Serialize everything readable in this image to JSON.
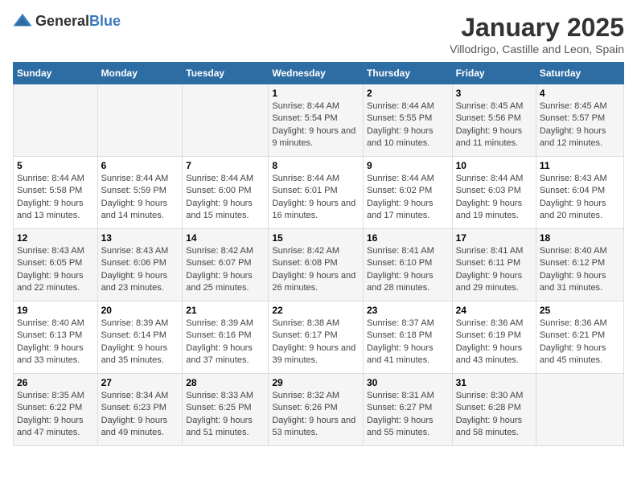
{
  "header": {
    "logo_general": "General",
    "logo_blue": "Blue",
    "title": "January 2025",
    "subtitle": "Villodrigo, Castille and Leon, Spain"
  },
  "days_of_week": [
    "Sunday",
    "Monday",
    "Tuesday",
    "Wednesday",
    "Thursday",
    "Friday",
    "Saturday"
  ],
  "weeks": [
    [
      {
        "day": "",
        "info": ""
      },
      {
        "day": "",
        "info": ""
      },
      {
        "day": "",
        "info": ""
      },
      {
        "day": "1",
        "info": "Sunrise: 8:44 AM\nSunset: 5:54 PM\nDaylight: 9 hours and 9 minutes."
      },
      {
        "day": "2",
        "info": "Sunrise: 8:44 AM\nSunset: 5:55 PM\nDaylight: 9 hours and 10 minutes."
      },
      {
        "day": "3",
        "info": "Sunrise: 8:45 AM\nSunset: 5:56 PM\nDaylight: 9 hours and 11 minutes."
      },
      {
        "day": "4",
        "info": "Sunrise: 8:45 AM\nSunset: 5:57 PM\nDaylight: 9 hours and 12 minutes."
      }
    ],
    [
      {
        "day": "5",
        "info": "Sunrise: 8:44 AM\nSunset: 5:58 PM\nDaylight: 9 hours and 13 minutes."
      },
      {
        "day": "6",
        "info": "Sunrise: 8:44 AM\nSunset: 5:59 PM\nDaylight: 9 hours and 14 minutes."
      },
      {
        "day": "7",
        "info": "Sunrise: 8:44 AM\nSunset: 6:00 PM\nDaylight: 9 hours and 15 minutes."
      },
      {
        "day": "8",
        "info": "Sunrise: 8:44 AM\nSunset: 6:01 PM\nDaylight: 9 hours and 16 minutes."
      },
      {
        "day": "9",
        "info": "Sunrise: 8:44 AM\nSunset: 6:02 PM\nDaylight: 9 hours and 17 minutes."
      },
      {
        "day": "10",
        "info": "Sunrise: 8:44 AM\nSunset: 6:03 PM\nDaylight: 9 hours and 19 minutes."
      },
      {
        "day": "11",
        "info": "Sunrise: 8:43 AM\nSunset: 6:04 PM\nDaylight: 9 hours and 20 minutes."
      }
    ],
    [
      {
        "day": "12",
        "info": "Sunrise: 8:43 AM\nSunset: 6:05 PM\nDaylight: 9 hours and 22 minutes."
      },
      {
        "day": "13",
        "info": "Sunrise: 8:43 AM\nSunset: 6:06 PM\nDaylight: 9 hours and 23 minutes."
      },
      {
        "day": "14",
        "info": "Sunrise: 8:42 AM\nSunset: 6:07 PM\nDaylight: 9 hours and 25 minutes."
      },
      {
        "day": "15",
        "info": "Sunrise: 8:42 AM\nSunset: 6:08 PM\nDaylight: 9 hours and 26 minutes."
      },
      {
        "day": "16",
        "info": "Sunrise: 8:41 AM\nSunset: 6:10 PM\nDaylight: 9 hours and 28 minutes."
      },
      {
        "day": "17",
        "info": "Sunrise: 8:41 AM\nSunset: 6:11 PM\nDaylight: 9 hours and 29 minutes."
      },
      {
        "day": "18",
        "info": "Sunrise: 8:40 AM\nSunset: 6:12 PM\nDaylight: 9 hours and 31 minutes."
      }
    ],
    [
      {
        "day": "19",
        "info": "Sunrise: 8:40 AM\nSunset: 6:13 PM\nDaylight: 9 hours and 33 minutes."
      },
      {
        "day": "20",
        "info": "Sunrise: 8:39 AM\nSunset: 6:14 PM\nDaylight: 9 hours and 35 minutes."
      },
      {
        "day": "21",
        "info": "Sunrise: 8:39 AM\nSunset: 6:16 PM\nDaylight: 9 hours and 37 minutes."
      },
      {
        "day": "22",
        "info": "Sunrise: 8:38 AM\nSunset: 6:17 PM\nDaylight: 9 hours and 39 minutes."
      },
      {
        "day": "23",
        "info": "Sunrise: 8:37 AM\nSunset: 6:18 PM\nDaylight: 9 hours and 41 minutes."
      },
      {
        "day": "24",
        "info": "Sunrise: 8:36 AM\nSunset: 6:19 PM\nDaylight: 9 hours and 43 minutes."
      },
      {
        "day": "25",
        "info": "Sunrise: 8:36 AM\nSunset: 6:21 PM\nDaylight: 9 hours and 45 minutes."
      }
    ],
    [
      {
        "day": "26",
        "info": "Sunrise: 8:35 AM\nSunset: 6:22 PM\nDaylight: 9 hours and 47 minutes."
      },
      {
        "day": "27",
        "info": "Sunrise: 8:34 AM\nSunset: 6:23 PM\nDaylight: 9 hours and 49 minutes."
      },
      {
        "day": "28",
        "info": "Sunrise: 8:33 AM\nSunset: 6:25 PM\nDaylight: 9 hours and 51 minutes."
      },
      {
        "day": "29",
        "info": "Sunrise: 8:32 AM\nSunset: 6:26 PM\nDaylight: 9 hours and 53 minutes."
      },
      {
        "day": "30",
        "info": "Sunrise: 8:31 AM\nSunset: 6:27 PM\nDaylight: 9 hours and 55 minutes."
      },
      {
        "day": "31",
        "info": "Sunrise: 8:30 AM\nSunset: 6:28 PM\nDaylight: 9 hours and 58 minutes."
      },
      {
        "day": "",
        "info": ""
      }
    ]
  ]
}
